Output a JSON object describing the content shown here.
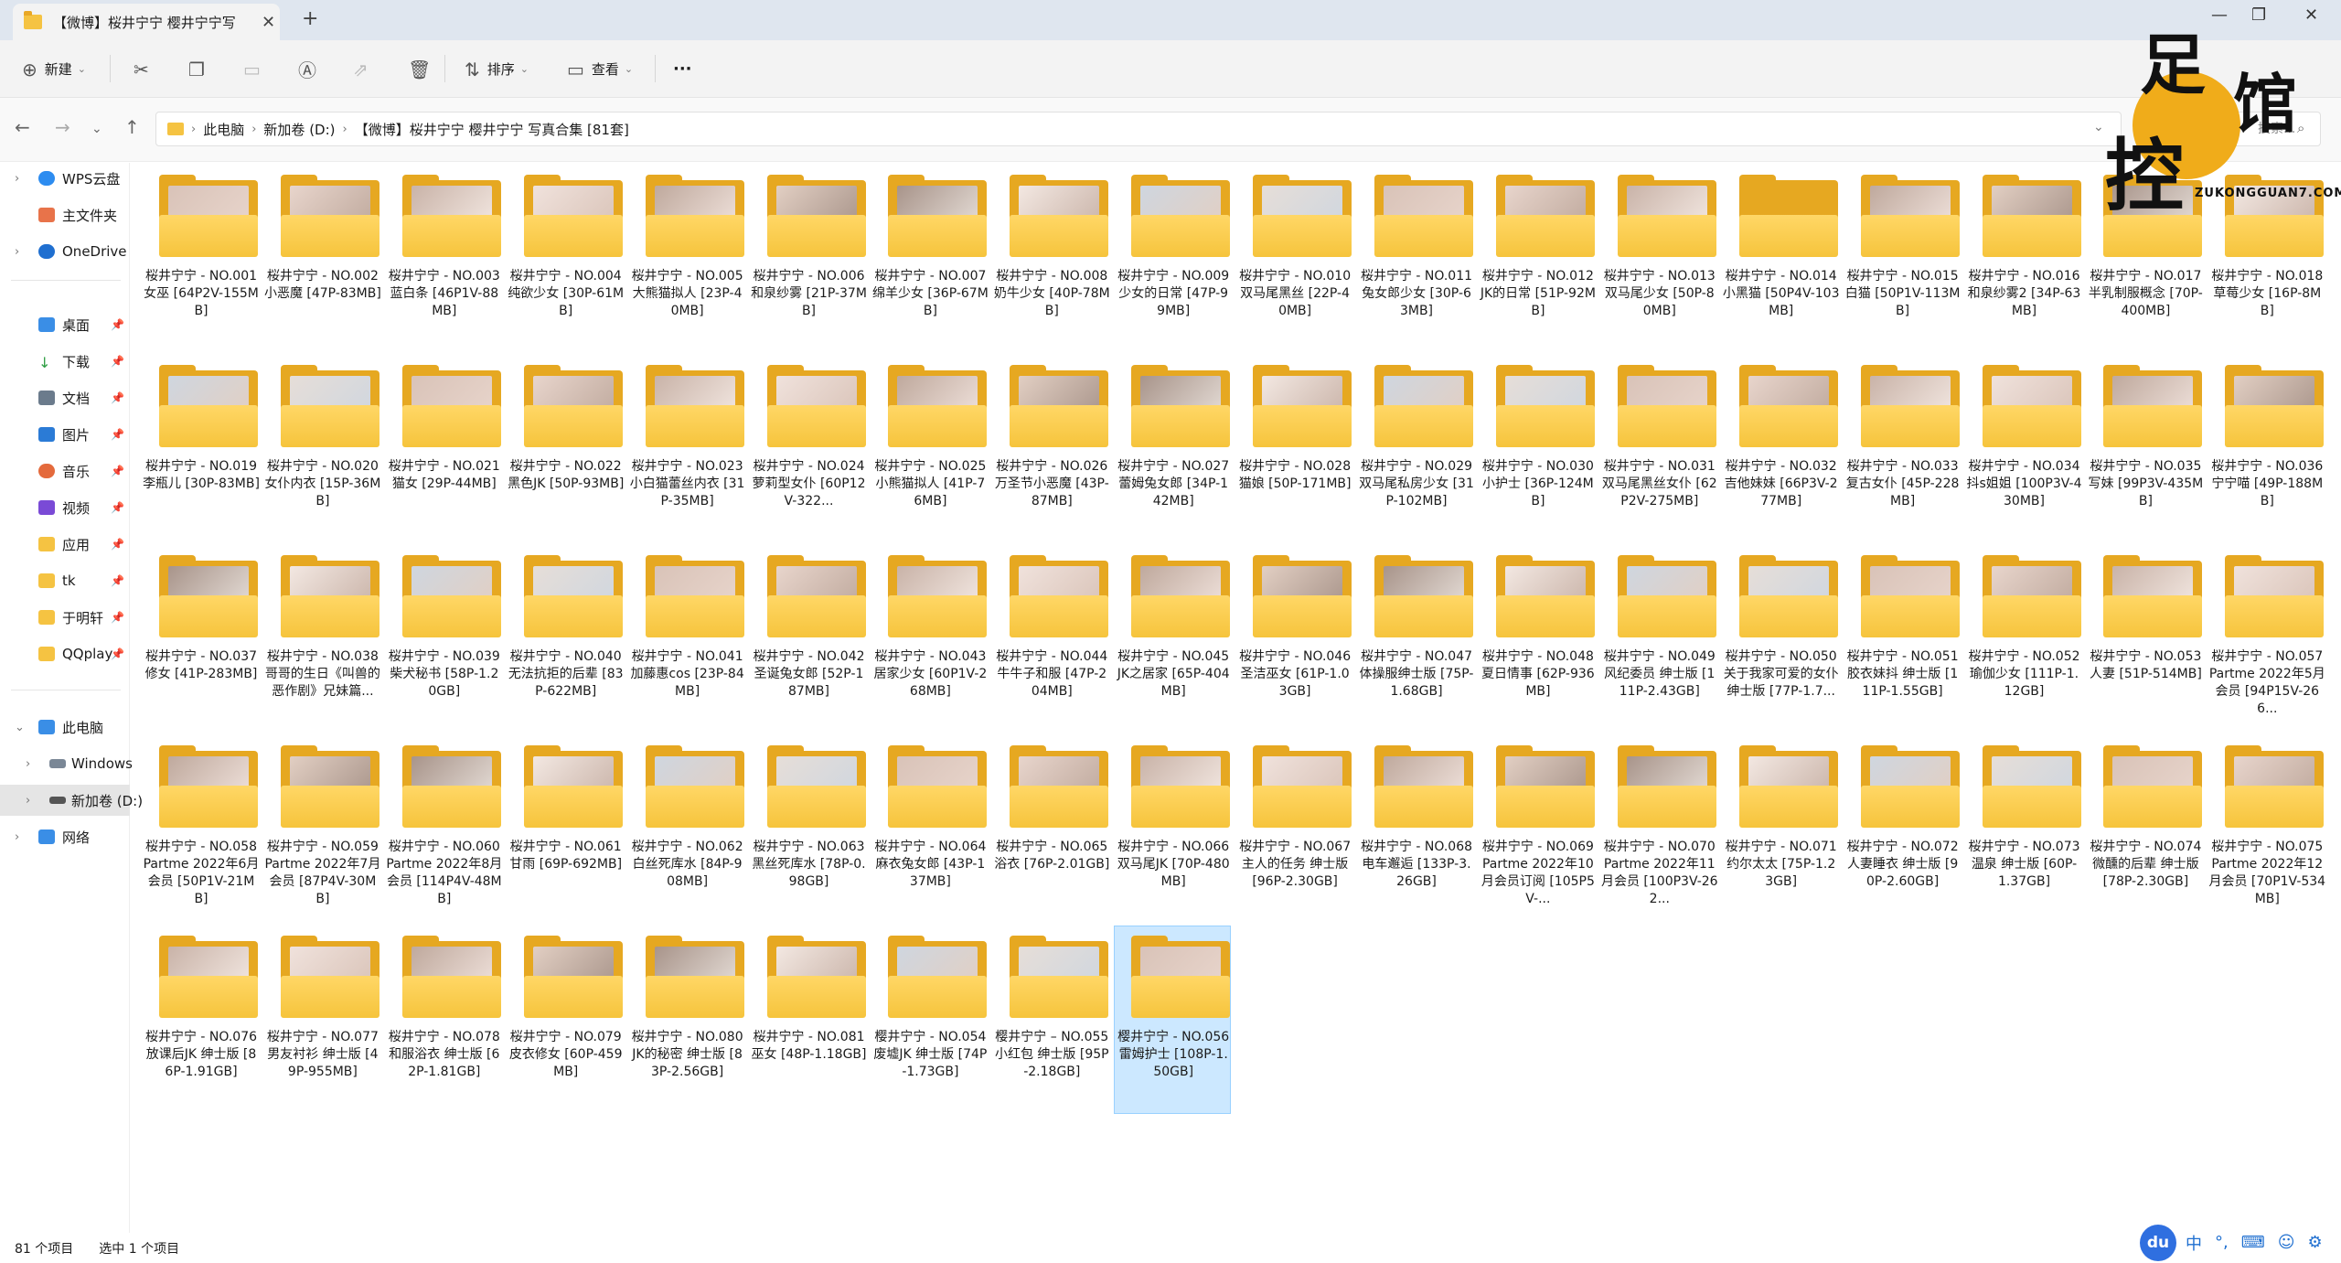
{
  "window": {
    "tab_title": "【微博】桜井宁宁 樱井宁宁写",
    "minimize_icon": "minimize-icon",
    "maximize_icon": "maximize-icon",
    "close_icon": "close-icon"
  },
  "toolbar": {
    "new_label": "新建",
    "sort_label": "排序",
    "view_label": "查看",
    "more_label": "···"
  },
  "address": {
    "crumbs": [
      "此电脑",
      "新加卷 (D:)",
      "【微博】桜井宁宁 樱井宁宁 写真合集 [81套]"
    ],
    "search_placeholder": "搜索..."
  },
  "sidebar": {
    "items": [
      {
        "label": "WPS云盘"
      },
      {
        "label": "主文件夹"
      },
      {
        "label": "OneDrive"
      },
      {
        "label": "桌面"
      },
      {
        "label": "下载"
      },
      {
        "label": "文档"
      },
      {
        "label": "图片"
      },
      {
        "label": "音乐"
      },
      {
        "label": "视频"
      },
      {
        "label": "应用"
      },
      {
        "label": "tk"
      },
      {
        "label": "于明轩"
      },
      {
        "label": "QQplay"
      },
      {
        "label": "此电脑"
      },
      {
        "label": "Windows"
      },
      {
        "label": "新加卷 (D:)"
      },
      {
        "label": "网络"
      }
    ]
  },
  "files": [
    "桜井宁宁 - NO.001 女巫 [64P2V-155MB]",
    "桜井宁宁 - NO.002 小恶魔 [47P-83MB]",
    "桜井宁宁 - NO.003 蓝白条 [46P1V-88MB]",
    "桜井宁宁 - NO.004 纯欲少女 [30P-61MB]",
    "桜井宁宁 - NO.005 大熊猫拟人 [23P-40MB]",
    "桜井宁宁 - NO.006 和泉纱雾 [21P-37MB]",
    "桜井宁宁 - NO.007 绵羊少女 [36P-67MB]",
    "桜井宁宁 - NO.008 奶牛少女 [40P-78MB]",
    "桜井宁宁 - NO.009 少女的日常 [47P-99MB]",
    "桜井宁宁 - NO.010 双马尾黑丝 [22P-40MB]",
    "桜井宁宁 - NO.011 兔女郎少女 [30P-63MB]",
    "桜井宁宁 - NO.012 JK的日常 [51P-92MB]",
    "桜井宁宁 - NO.013 双马尾少女 [50P-80MB]",
    "桜井宁宁 - NO.014 小黑猫 [50P4V-103MB]",
    "桜井宁宁 - NO.015 白猫 [50P1V-113MB]",
    "桜井宁宁 - NO.016 和泉纱雾2 [34P-63MB]",
    "桜井宁宁 - NO.017 半乳制服概念 [70P-400MB]",
    "桜井宁宁 - NO.018 草莓少女 [16P-8MB]",
    "桜井宁宁 - NO.019 李瓶儿 [30P-83MB]",
    "桜井宁宁 - NO.020 女仆内衣 [15P-36MB]",
    "桜井宁宁 - NO.021 猫女 [29P-44MB]",
    "桜井宁宁 - NO.022 黑色JK [50P-93MB]",
    "桜井宁宁 - NO.023 小白猫蕾丝内衣 [31P-35MB]",
    "桜井宁宁 - NO.024 萝莉型女仆 [60P12V-322...",
    "桜井宁宁 - NO.025 小熊猫拟人 [41P-76MB]",
    "桜井宁宁 - NO.026 万圣节小恶魔 [43P-87MB]",
    "桜井宁宁 - NO.027 蕾姆兔女郎 [34P-142MB]",
    "桜井宁宁 - NO.028 猫娘 [50P-171MB]",
    "桜井宁宁 - NO.029 双马尾私房少女 [31P-102MB]",
    "桜井宁宁 - NO.030 小护士 [36P-124MB]",
    "桜井宁宁 - NO.031 双马尾黑丝女仆 [62P2V-275MB]",
    "桜井宁宁 - NO.032 吉他妹妹 [66P3V-277MB]",
    "桜井宁宁 - NO.033 复古女仆 [45P-228MB]",
    "桜井宁宁 - NO.034 抖s姐姐 [100P3V-430MB]",
    "桜井宁宁 - NO.035 写妹 [99P3V-435MB]",
    "桜井宁宁 - NO.036 宁宁喵 [49P-188MB]",
    "桜井宁宁 - NO.037 修女 [41P-283MB]",
    "桜井宁宁 - NO.038 哥哥的生日《叫兽的恶作剧》兄妹篇...",
    "桜井宁宁 - NO.039 柴犬秘书 [58P-1.20GB]",
    "桜井宁宁 - NO.040 无法抗拒的后辈 [83P-622MB]",
    "桜井宁宁 - NO.041 加藤惠cos [23P-84MB]",
    "桜井宁宁 - NO.042 圣诞兔女郎 [52P-187MB]",
    "桜井宁宁 - NO.043 居家少女 [60P1V-268MB]",
    "桜井宁宁 - NO.044 牛牛子和服 [47P-204MB]",
    "桜井宁宁 - NO.045 JK之居家 [65P-404MB]",
    "桜井宁宁 - NO.046 圣洁巫女 [61P-1.03GB]",
    "桜井宁宁 - NO.047 体操服绅士版 [75P-1.68GB]",
    "桜井宁宁 - NO.048 夏日情事 [62P-936MB]",
    "桜井宁宁 - NO.049 风纪委员 绅士版 [111P-2.43GB]",
    "桜井宁宁 - NO.050 关于我家可爱的女仆 绅士版 [77P-1.7...",
    "桜井宁宁 - NO.051 胶衣妹抖 绅士版 [111P-1.55GB]",
    "桜井宁宁 - NO.052 瑜伽少女 [111P-1.12GB]",
    "桜井宁宁 - NO.053 人妻 [51P-514MB]",
    "桜井宁宁 - NO.057 Partme 2022年5月会员 [94P15V-266...",
    "桜井宁宁 - NO.058 Partme 2022年6月会员 [50P1V-21MB]",
    "桜井宁宁 - NO.059 Partme 2022年7月会员 [87P4V-30MB]",
    "桜井宁宁 - NO.060 Partme 2022年8月会员 [114P4V-48MB]",
    "桜井宁宁 - NO.061 甘雨 [69P-692MB]",
    "桜井宁宁 - NO.062 白丝死库水 [84P-908MB]",
    "桜井宁宁 - NO.063 黑丝死库水 [78P-0.98GB]",
    "桜井宁宁 - NO.064 麻衣兔女郎 [43P-137MB]",
    "桜井宁宁 - NO.065 浴衣 [76P-2.01GB]",
    "桜井宁宁 - NO.066 双马尾JK [70P-480MB]",
    "桜井宁宁 - NO.067 主人的任务 绅士版 [96P-2.30GB]",
    "桜井宁宁 - NO.068 电车邂逅 [133P-3.26GB]",
    "桜井宁宁 - NO.069 Partme 2022年10月会员订阅 [105P5V-...",
    "桜井宁宁 - NO.070 Partme 2022年11月会员 [100P3V-262...",
    "桜井宁宁 - NO.071 约尔太太 [75P-1.23GB]",
    "桜井宁宁 - NO.072 人妻睡衣 绅士版 [90P-2.60GB]",
    "桜井宁宁 - NO.073 温泉 绅士版 [60P-1.37GB]",
    "桜井宁宁 - NO.074 微醺的后辈 绅士版 [78P-2.30GB]",
    "桜井宁宁 - NO.075 Partme 2022年12月会员 [70P1V-534MB]",
    "桜井宁宁 - NO.076 放课后JK 绅士版 [86P-1.91GB]",
    "桜井宁宁 - NO.077 男友衬衫 绅士版 [49P-955MB]",
    "桜井宁宁 - NO.078 和服浴衣 绅士版 [62P-1.81GB]",
    "桜井宁宁 - NO.079 皮衣修女 [60P-459MB]",
    "桜井宁宁 - NO.080 JK的秘密 绅士版 [83P-2.56GB]",
    "桜井宁宁 - NO.081 巫女 [48P-1.18GB]",
    "樱井宁宁 - NO.054 废墟JK 绅士版 [74P-1.73GB]",
    "樱井宁宁 – NO.055 小红包 绅士版 [95P-2.18GB]",
    "樱井宁宁 - NO.056 雷姆护士 [108P-1.50GB]"
  ],
  "selected_index": 80,
  "status": {
    "count": "81 个项目",
    "selected": "选中 1 个项目"
  },
  "watermark": {
    "char1": "足",
    "char2": "馆",
    "char3": "控",
    "url": "ZUKONGGUAN7.COM"
  },
  "tray": {
    "logo": "du",
    "ime": "中",
    "icons": [
      "punctuation-icon",
      "keyboard-icon",
      "person-icon",
      "settings-icon"
    ]
  }
}
